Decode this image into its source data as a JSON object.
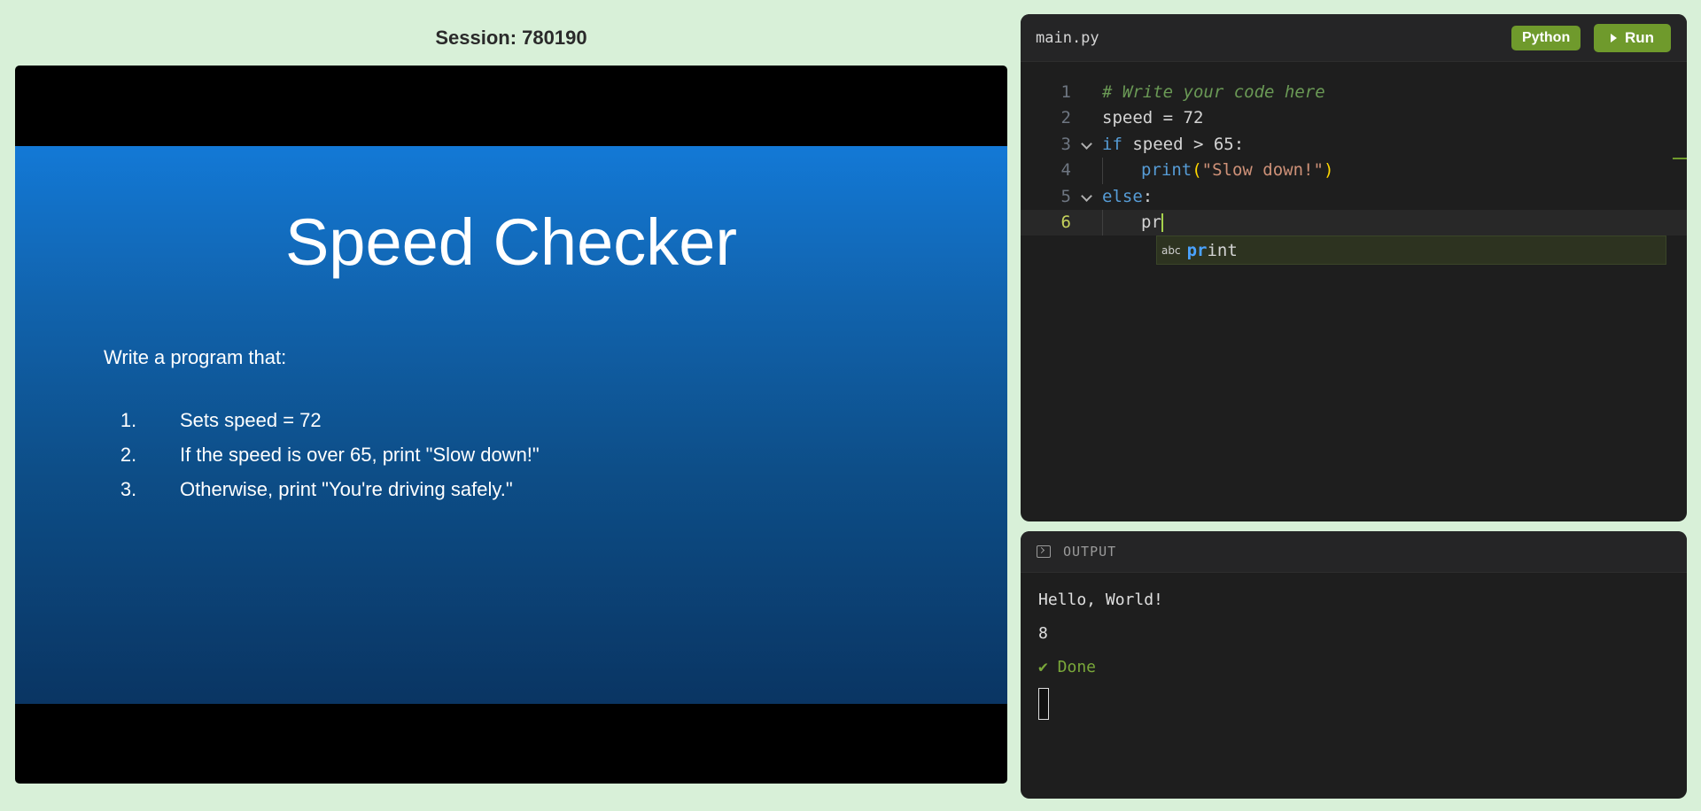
{
  "session": {
    "title": "Session: 780190"
  },
  "slide": {
    "heading": "Speed Checker",
    "intro": "Write a program that:",
    "steps": [
      {
        "num": "1.",
        "text": "Sets speed = 72"
      },
      {
        "num": "2.",
        "text": "If the speed is over 65, print \"Slow down!\""
      },
      {
        "num": "3.",
        "text": "Otherwise, print \"You're driving safely.\""
      }
    ]
  },
  "editor": {
    "filename": "main.py",
    "language": "Python",
    "run_label": "Run",
    "line_numbers": [
      "1",
      "2",
      "3",
      "4",
      "5",
      "6"
    ],
    "lines": {
      "l1": "# Write your code here",
      "l2": "speed = 72",
      "l3_kw": "if",
      "l3_rest": " speed > 65:",
      "l4_fn": "print",
      "l4_open": "(",
      "l4_str": "\"Slow down!\"",
      "l4_close": ")",
      "l5_kw": "else",
      "l5_rest": ":",
      "l6": "pr"
    },
    "suggestion": {
      "icon": "abc",
      "match": "pr",
      "rest": "int"
    }
  },
  "output": {
    "title": "OUTPUT",
    "lines": [
      "Hello, World!",
      "8"
    ],
    "status": "✔ Done"
  },
  "colors": {
    "background": "#d8f0d8",
    "accent": "#6f9a2c",
    "slide_top": "#1379d6",
    "slide_bottom": "#0a3563"
  }
}
